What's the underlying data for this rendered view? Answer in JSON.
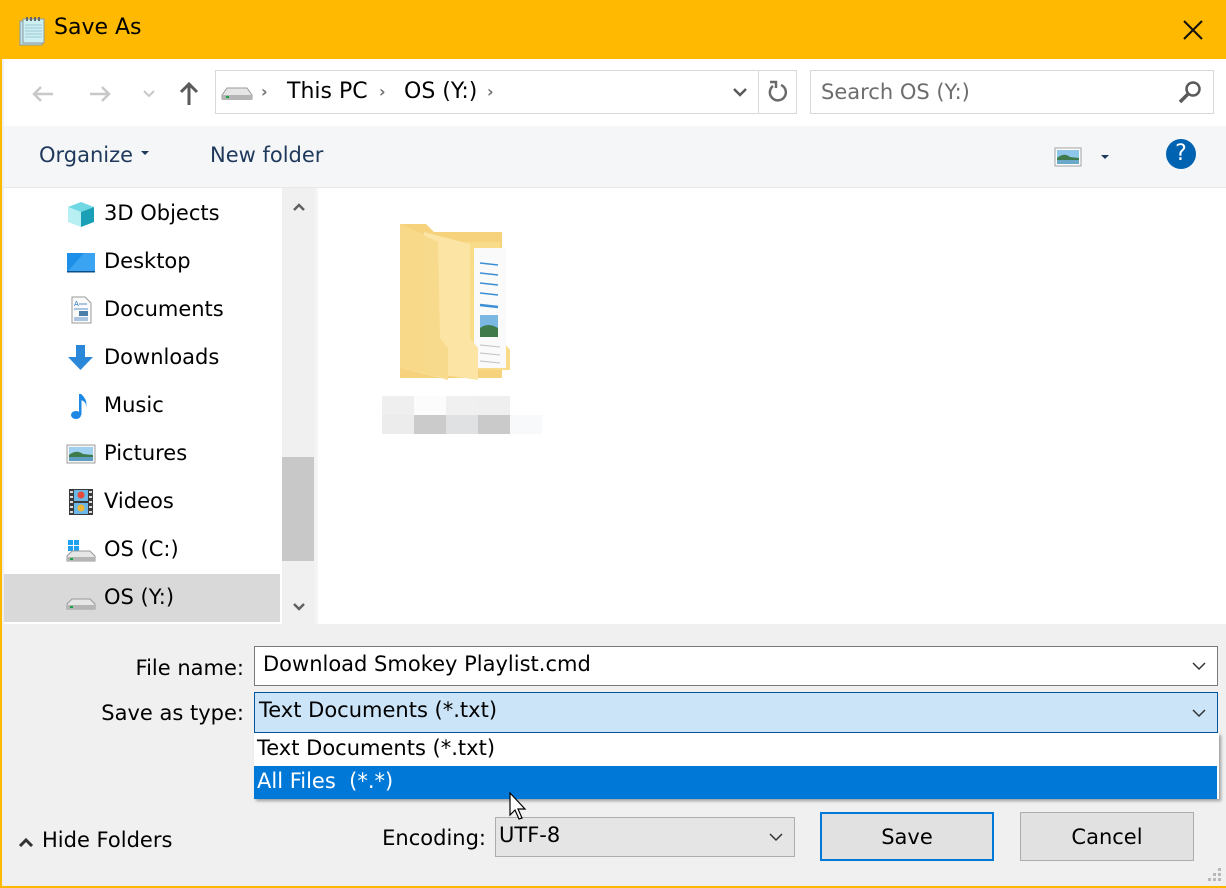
{
  "window": {
    "title": "Save As",
    "app_icon": "notepad-icon",
    "close_icon": "close-icon"
  },
  "navbar": {
    "back_icon": "arrow-left-icon",
    "forward_icon": "arrow-right-icon",
    "recent_icon": "chevron-down-icon",
    "up_icon": "arrow-up-icon",
    "breadcrumb": [
      "This PC",
      "OS (Y:)"
    ],
    "refresh_icon": "refresh-icon",
    "search_placeholder": "Search OS (Y:)",
    "search_value": ""
  },
  "commandbar": {
    "organize": "Organize",
    "new_folder": "New folder",
    "view_icon": "picture-view-icon",
    "help": "?"
  },
  "sidebar": {
    "items": [
      {
        "label": "3D Objects",
        "icon": "3d-objects-icon",
        "selected": false
      },
      {
        "label": "Desktop",
        "icon": "desktop-icon",
        "selected": false
      },
      {
        "label": "Documents",
        "icon": "documents-icon",
        "selected": false
      },
      {
        "label": "Downloads",
        "icon": "downloads-icon",
        "selected": false
      },
      {
        "label": "Music",
        "icon": "music-icon",
        "selected": false
      },
      {
        "label": "Pictures",
        "icon": "pictures-icon",
        "selected": false
      },
      {
        "label": "Videos",
        "icon": "videos-icon",
        "selected": false
      },
      {
        "label": "OS (C:)",
        "icon": "windows-drive-icon",
        "selected": false
      },
      {
        "label": "OS (Y:)",
        "icon": "drive-icon",
        "selected": true
      }
    ]
  },
  "content": {
    "items": [
      {
        "type": "folder",
        "label_obscured": true
      }
    ]
  },
  "form": {
    "filename_label": "File name:",
    "filename_value": "Download Smokey Playlist.cmd",
    "savetype_label": "Save as type:",
    "savetype_value": "Text Documents (*.txt)",
    "savetype_options": [
      "Text Documents (*.txt)",
      "All Files  (*.*)"
    ],
    "savetype_highlighted_index": 1,
    "encoding_label": "Encoding:",
    "encoding_value": "UTF-8",
    "hide_folders": "Hide Folders",
    "save": "Save",
    "cancel": "Cancel"
  },
  "colors": {
    "titlebar": "#ffb900",
    "accent": "#0078d7",
    "selection_light": "#cce4f7",
    "help_blue": "#0063b1"
  }
}
